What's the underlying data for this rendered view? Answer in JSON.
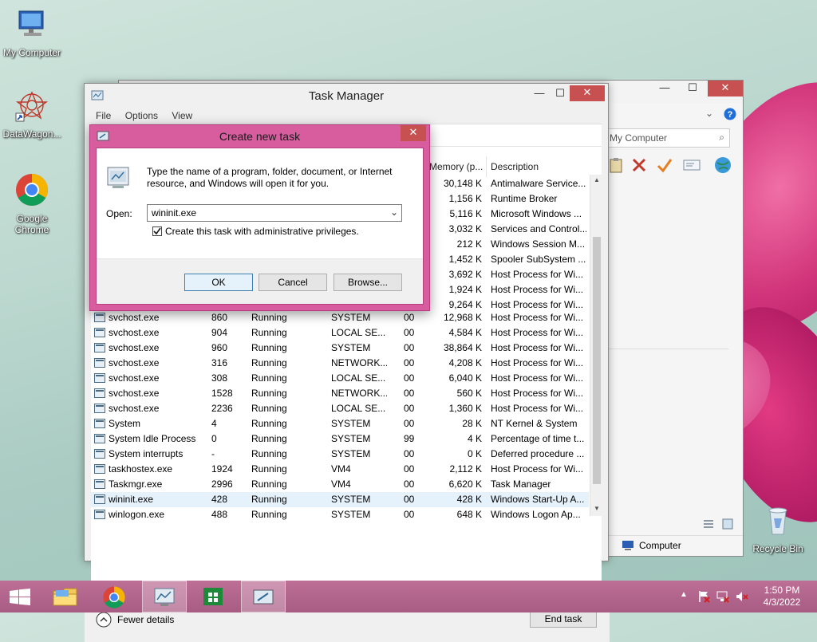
{
  "desktop": {
    "icons": [
      {
        "label": "My Computer"
      },
      {
        "label": "DataWagon..."
      },
      {
        "label": "Google Chrome"
      },
      {
        "label": "Recycle Bin"
      }
    ]
  },
  "explorer": {
    "search_placeholder": "My Computer",
    "status_label": "Computer"
  },
  "task_manager": {
    "title": "Task Manager",
    "menu": [
      "File",
      "Options",
      "View"
    ],
    "columns": {
      "memory": "Memory (p...",
      "description": "Description"
    },
    "background_rows": [
      {
        "mem": "30,148 K",
        "desc": "Antimalware Service..."
      },
      {
        "mem": "1,156 K",
        "desc": "Runtime Broker"
      },
      {
        "mem": "5,116 K",
        "desc": "Microsoft Windows ..."
      },
      {
        "mem": "3,032 K",
        "desc": "Services and Control..."
      },
      {
        "mem": "212 K",
        "desc": "Windows Session M..."
      },
      {
        "mem": "1,452 K",
        "desc": "Spooler SubSystem ..."
      },
      {
        "mem": "3,692 K",
        "desc": "Host Process for Wi..."
      },
      {
        "mem": "1,924 K",
        "desc": "Host Process for Wi..."
      },
      {
        "mem": "9,264 K",
        "desc": "Host Process for Wi..."
      }
    ],
    "rows": [
      {
        "name": "svchost.exe",
        "pid": "860",
        "status": "Running",
        "user": "SYSTEM",
        "cpu": "00",
        "mem": "12,968 K",
        "desc": "Host Process for Wi..."
      },
      {
        "name": "svchost.exe",
        "pid": "904",
        "status": "Running",
        "user": "LOCAL SE...",
        "cpu": "00",
        "mem": "4,584 K",
        "desc": "Host Process for Wi..."
      },
      {
        "name": "svchost.exe",
        "pid": "960",
        "status": "Running",
        "user": "SYSTEM",
        "cpu": "00",
        "mem": "38,864 K",
        "desc": "Host Process for Wi..."
      },
      {
        "name": "svchost.exe",
        "pid": "316",
        "status": "Running",
        "user": "NETWORK...",
        "cpu": "00",
        "mem": "4,208 K",
        "desc": "Host Process for Wi..."
      },
      {
        "name": "svchost.exe",
        "pid": "308",
        "status": "Running",
        "user": "LOCAL SE...",
        "cpu": "00",
        "mem": "6,040 K",
        "desc": "Host Process for Wi..."
      },
      {
        "name": "svchost.exe",
        "pid": "1528",
        "status": "Running",
        "user": "NETWORK...",
        "cpu": "00",
        "mem": "560 K",
        "desc": "Host Process for Wi..."
      },
      {
        "name": "svchost.exe",
        "pid": "2236",
        "status": "Running",
        "user": "LOCAL SE...",
        "cpu": "00",
        "mem": "1,360 K",
        "desc": "Host Process for Wi..."
      },
      {
        "name": "System",
        "pid": "4",
        "status": "Running",
        "user": "SYSTEM",
        "cpu": "00",
        "mem": "28 K",
        "desc": "NT Kernel & System"
      },
      {
        "name": "System Idle Process",
        "pid": "0",
        "status": "Running",
        "user": "SYSTEM",
        "cpu": "99",
        "mem": "4 K",
        "desc": "Percentage of time t..."
      },
      {
        "name": "System interrupts",
        "pid": "-",
        "status": "Running",
        "user": "SYSTEM",
        "cpu": "00",
        "mem": "0 K",
        "desc": "Deferred procedure ..."
      },
      {
        "name": "taskhostex.exe",
        "pid": "1924",
        "status": "Running",
        "user": "VM4",
        "cpu": "00",
        "mem": "2,112 K",
        "desc": "Host Process for Wi..."
      },
      {
        "name": "Taskmgr.exe",
        "pid": "2996",
        "status": "Running",
        "user": "VM4",
        "cpu": "00",
        "mem": "6,620 K",
        "desc": "Task Manager"
      },
      {
        "name": "wininit.exe",
        "pid": "428",
        "status": "Running",
        "user": "SYSTEM",
        "cpu": "00",
        "mem": "428 K",
        "desc": "Windows Start-Up A..."
      },
      {
        "name": "winlogon.exe",
        "pid": "488",
        "status": "Running",
        "user": "SYSTEM",
        "cpu": "00",
        "mem": "648 K",
        "desc": "Windows Logon Ap..."
      }
    ],
    "fewer_details": "Fewer details",
    "end_task": "End task"
  },
  "dialog": {
    "title": "Create new task",
    "description": "Type the name of a program, folder, document, or Internet resource, and Windows will open it for you.",
    "open_label": "Open:",
    "open_value": "wininit.exe",
    "admin_label": "Create this task with administrative privileges.",
    "admin_checked": true,
    "ok": "OK",
    "cancel": "Cancel",
    "browse": "Browse..."
  },
  "taskbar": {
    "time": "1:50 PM",
    "date": "4/3/2022"
  },
  "colors": {
    "dialog_frame": "#d75d9f",
    "taskbar": "#b76a90",
    "close_button": "#c75050",
    "selected_row": "#e5f1fb"
  }
}
